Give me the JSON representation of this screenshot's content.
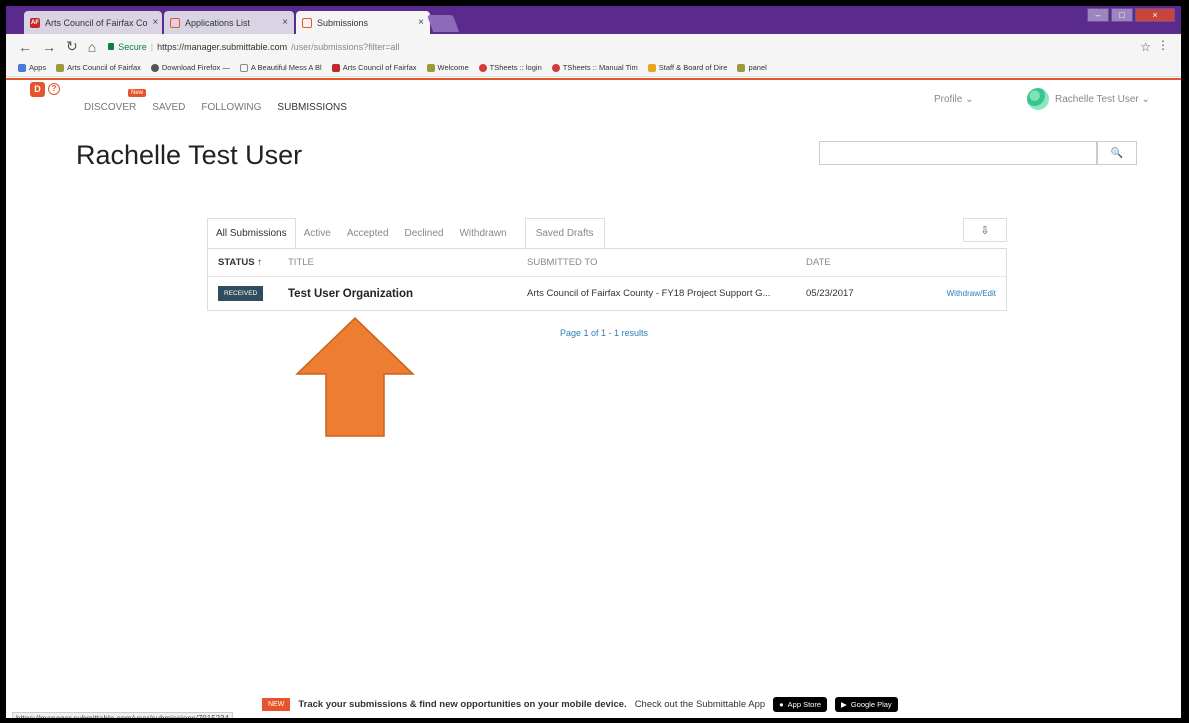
{
  "browser": {
    "tabs": [
      {
        "label": "Arts Council of Fairfax Co",
        "icon": "arts-council-icon"
      },
      {
        "label": "Applications List",
        "icon": "submittable-icon"
      },
      {
        "label": "Submissions",
        "icon": "submittable-icon"
      }
    ],
    "secure_label": "Secure",
    "url_main": "https://manager.submittable.com",
    "url_path": "/user/submissions?filter=all",
    "bookmarks": [
      "Apps",
      "Arts Council of Fairfax",
      "Download Firefox —",
      "A Beautiful Mess A Bl",
      "Arts Council of Fairfax",
      "Welcome",
      "TSheets :: login",
      "TSheets :: Manual Tim",
      "Staff & Board of Dire",
      "panel"
    ]
  },
  "header": {
    "nav": [
      "DISCOVER",
      "SAVED",
      "FOLLOWING",
      "SUBMISSIONS"
    ],
    "new_badge": "New",
    "profile_label": "Profile ⌄",
    "user_label": "Rachelle Test User ⌄"
  },
  "page": {
    "title": "Rachelle Test User",
    "search_placeholder": "",
    "search_icon": "🔍"
  },
  "filters": {
    "tabs": [
      "All Submissions",
      "Active",
      "Accepted",
      "Declined",
      "Withdrawn"
    ],
    "drafts": "Saved Drafts",
    "download_icon": "⇩"
  },
  "table": {
    "headers": {
      "status": "STATUS ↑",
      "title": "TITLE",
      "submitted_to": "SUBMITTED TO",
      "date": "DATE"
    },
    "rows": [
      {
        "status": "RECEIVED",
        "title": "Test User Organization",
        "submitted_to": "Arts Council of Fairfax County - FY18 Project Support G...",
        "date": "05/23/2017",
        "withdraw": "Withdraw",
        "sep": "/",
        "edit": "Edit"
      }
    ],
    "pager": "Page 1 of 1 - 1 results"
  },
  "status_url": "https://manager.submittable.com/user/submissions/7915234",
  "footer": {
    "new": "NEW",
    "headline": "Track your submissions & find new opportunities on your mobile device.",
    "cta": "Check out the Submittable App",
    "app_store": "App Store",
    "google_play": "Google Play"
  },
  "colors": {
    "accent": "#e8542a",
    "arrow": "#ed7d31",
    "badge": "#2f4d5f",
    "link": "#2a7fb8"
  }
}
